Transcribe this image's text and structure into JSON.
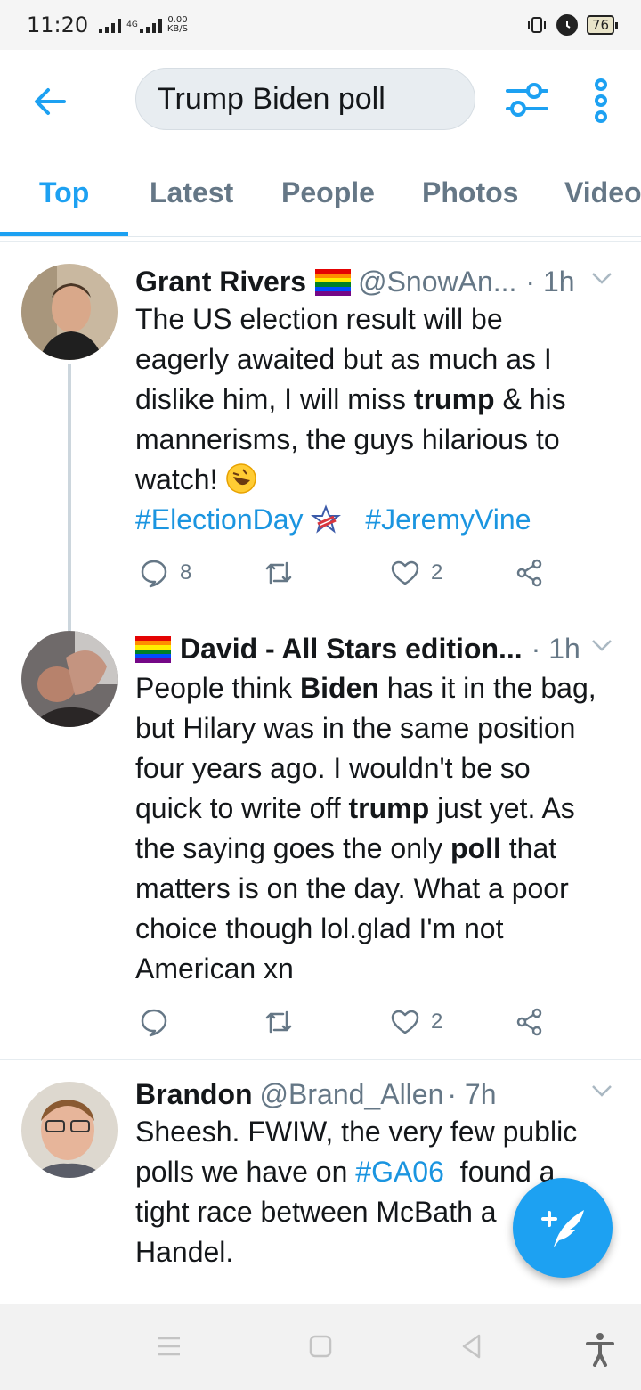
{
  "status_bar": {
    "time": "11:20",
    "network_type": "4G",
    "speed_value": "0.00",
    "speed_unit": "KB/S",
    "battery": "76"
  },
  "header": {
    "search_value": "Trump Biden poll"
  },
  "tabs": [
    {
      "label": "Top",
      "active": true
    },
    {
      "label": "Latest",
      "active": false
    },
    {
      "label": "People",
      "active": false
    },
    {
      "label": "Photos",
      "active": false
    },
    {
      "label": "Videos",
      "active": false
    }
  ],
  "tweets": [
    {
      "name": "Grant Rivers",
      "handle": "@SnowAn...",
      "time": "· 1h",
      "text_lines": [
        [
          "The US election result will be"
        ],
        [
          "eagerly awaited but as much as I"
        ],
        [
          "dislike him, I will miss ",
          "trump",
          " & his"
        ],
        [
          "mannerisms, the guys hilarious to"
        ],
        [
          "watch! "
        ]
      ],
      "hashtags": [
        "#ElectionDay",
        "#JeremyVine"
      ],
      "replies": "8",
      "retweets": "",
      "likes": "2"
    },
    {
      "name": "David - All Stars edition...",
      "handle": "",
      "time": "· 1h",
      "text_lines": [
        [
          "People think ",
          "Biden",
          " has it in the bag,"
        ],
        [
          "but Hilary was in the same position"
        ],
        [
          "four years ago. I wouldn't be so"
        ],
        [
          "quick to write off ",
          "trump",
          " just yet. As"
        ],
        [
          "the saying goes the only ",
          "poll",
          " that"
        ],
        [
          "matters is on the day. What a poor"
        ],
        [
          "choice though lol.glad I'm not"
        ],
        [
          "American xn"
        ]
      ],
      "replies": "",
      "retweets": "",
      "likes": "2"
    },
    {
      "name": "Brandon",
      "handle": "@Brand_Allen",
      "time": "· 7h",
      "text_line1": "Sheesh. FWIW, the very few public",
      "text_line2_a": "polls we have on ",
      "text_line2_tag": "#GA06",
      "text_line2_b": "  found a",
      "text_line3": "tight race between McBath a",
      "text_line4": "Handel."
    }
  ],
  "colors": {
    "accent": "#1da1f2",
    "hashtag": "#1b95e0",
    "muted": "#657786"
  },
  "icons": [
    "back-arrow-icon",
    "filter-icon",
    "more-vertical-icon",
    "reply-icon",
    "retweet-icon",
    "like-icon",
    "share-icon",
    "compose-tweet-icon",
    "rainbow-flag-icon",
    "laughing-emoji-icon",
    "star-flag-icon"
  ]
}
